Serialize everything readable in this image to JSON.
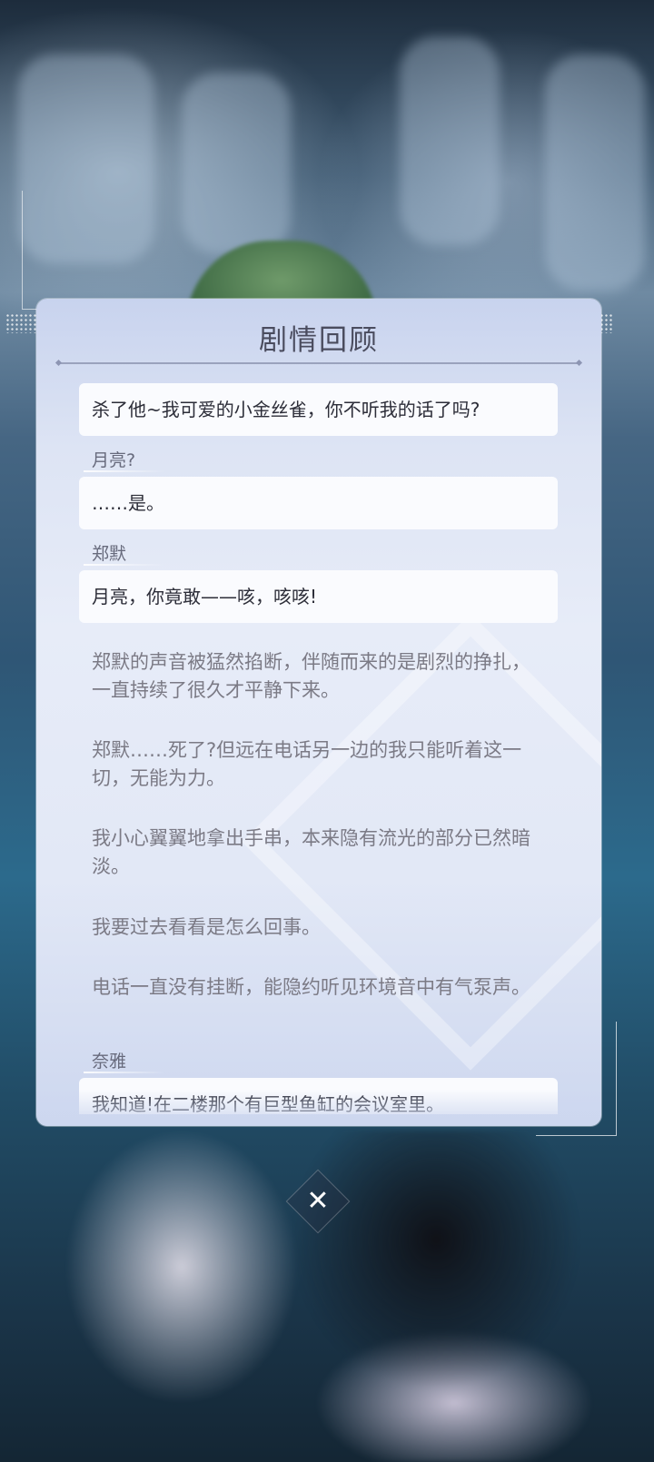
{
  "dialog": {
    "title": "剧情回顾",
    "close_icon": "close-icon"
  },
  "log": [
    {
      "type": "line",
      "speaker": "",
      "text": "杀了他~我可爱的小金丝雀，你不听我的话了吗?"
    },
    {
      "type": "line",
      "speaker": "月亮?",
      "text": "……是。"
    },
    {
      "type": "line",
      "speaker": "郑默",
      "text": "月亮，你竟敢——咳，咳咳!"
    },
    {
      "type": "narration",
      "text": "郑默的声音被猛然掐断，伴随而来的是剧烈的挣扎，一直持续了很久才平静下来。"
    },
    {
      "type": "narration",
      "text": "郑默……死了?但远在电话另一边的我只能听着这一切，无能为力。"
    },
    {
      "type": "narration",
      "text": "我小心翼翼地拿出手串，本来隐有流光的部分已然暗淡。"
    },
    {
      "type": "narration",
      "text": "我要过去看看是怎么回事。"
    },
    {
      "type": "narration",
      "text": "电话一直没有挂断，能隐约听见环境音中有气泵声。"
    },
    {
      "type": "line",
      "speaker": "奈雅",
      "text": "我知道!在二楼那个有巨型鱼缸的会议室里。"
    }
  ]
}
